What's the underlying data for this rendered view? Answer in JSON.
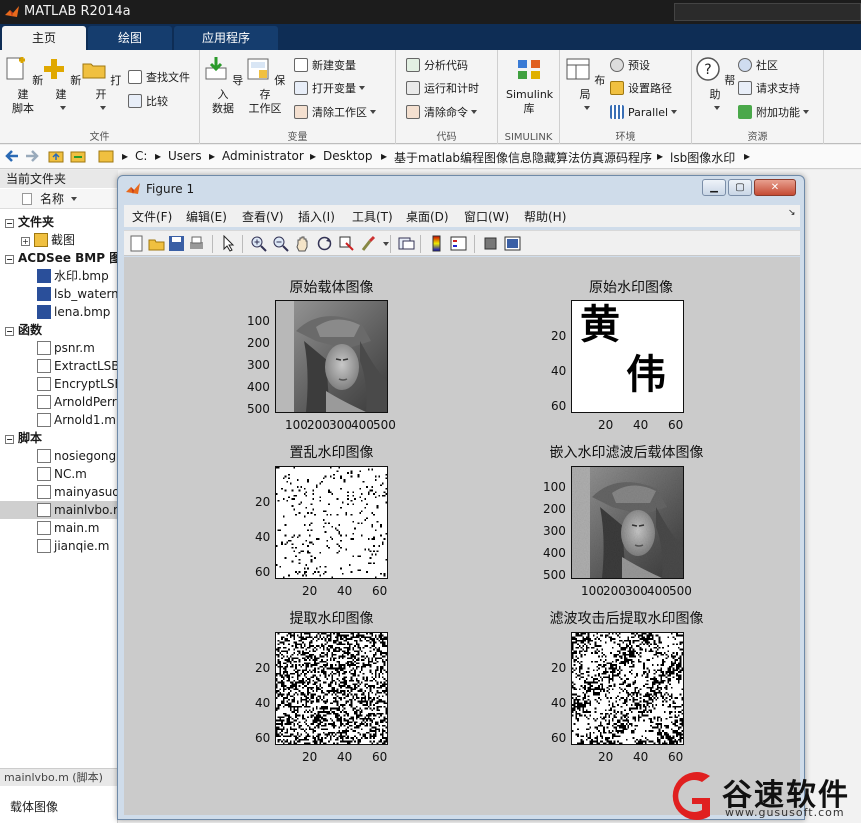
{
  "app": {
    "title": "MATLAB R2014a"
  },
  "tabs": [
    {
      "label": "主页"
    },
    {
      "label": "绘图"
    },
    {
      "label": "应用程序"
    }
  ],
  "ribbon": {
    "file_group": {
      "label": "文件",
      "new_script": "新建\n脚本",
      "new": "新建",
      "open": "打开",
      "find_files": "查找文件",
      "compare": "比较"
    },
    "variable_group": {
      "label": "变量",
      "import": "导入\n数据",
      "save_ws": "保存\n工作区",
      "new_var": "新建变量",
      "open_var": "打开变量",
      "clear_ws": "清除工作区"
    },
    "code_group": {
      "label": "代码",
      "analyze": "分析代码",
      "run_time": "运行和计时",
      "clear_cmd": "清除命令"
    },
    "simulink_group": {
      "label": "SIMULINK",
      "simulink": "Simulink\n库"
    },
    "env_group": {
      "label": "环境",
      "layout": "布局",
      "prefs": "预设",
      "set_path": "设置路径",
      "parallel": "Parallel"
    },
    "resources_group": {
      "label": "资源",
      "help": "帮助",
      "community": "社区",
      "support": "请求支持",
      "addons": "附加功能"
    }
  },
  "address": {
    "segments": [
      "C:",
      "Users",
      "Administrator",
      "Desktop",
      "基于matlab编程图像信息隐藏算法仿真源码程序",
      "lsb图像水印"
    ]
  },
  "left_panel": {
    "header": "当前文件夹",
    "column": "名称",
    "sections": [
      {
        "label": "文件夹",
        "items": [
          "截图"
        ]
      },
      {
        "label": "ACDSee BMP 图",
        "items": [
          "水印.bmp",
          "lsb_waterm",
          "lena.bmp"
        ]
      },
      {
        "label": "函数",
        "items": [
          "psnr.m",
          "ExtractLSB",
          "EncryptLSB",
          "ArnoldPerr",
          "Arnold1.m"
        ]
      },
      {
        "label": "脚本",
        "items": [
          "nosiegong",
          "NC.m",
          "mainyasuo",
          "mainlvbo.m",
          "main.m",
          "jianqie.m"
        ]
      }
    ],
    "status": "mainlvbo.m (脚本)",
    "detail": "载体图像"
  },
  "figure": {
    "title": "Figure 1",
    "menus": [
      "文件(F)",
      "编辑(E)",
      "查看(V)",
      "插入(I)",
      "工具(T)",
      "桌面(D)",
      "窗口(W)",
      "帮助(H)"
    ],
    "plots": [
      {
        "title": "原始载体图像",
        "yticks": [
          "100",
          "200",
          "300",
          "400",
          "500"
        ],
        "xticks": [
          "100",
          "200",
          "300",
          "400",
          "500"
        ]
      },
      {
        "title": "原始水印图像",
        "yticks": [
          "20",
          "40",
          "60"
        ],
        "xticks": [
          "20",
          "40",
          "60"
        ],
        "glyph1": "黄",
        "glyph2": "伟"
      },
      {
        "title": "置乱水印图像",
        "yticks": [
          "20",
          "40",
          "60"
        ],
        "xticks": [
          "20",
          "40",
          "60"
        ]
      },
      {
        "title": "嵌入水印滤波后载体图像",
        "yticks": [
          "100",
          "200",
          "300",
          "400",
          "500"
        ],
        "xticks": [
          "100",
          "200",
          "300",
          "400",
          "500"
        ]
      },
      {
        "title": "提取水印图像",
        "yticks": [
          "20",
          "40",
          "60"
        ],
        "xticks": [
          "20",
          "40",
          "60"
        ]
      },
      {
        "title": "滤波攻击后提取水印图像",
        "yticks": [
          "20",
          "40",
          "60"
        ],
        "xticks": [
          "20",
          "40",
          "60"
        ]
      }
    ]
  },
  "watermark_site": {
    "brand": "谷速软件",
    "url": "www.gususoft.com"
  }
}
